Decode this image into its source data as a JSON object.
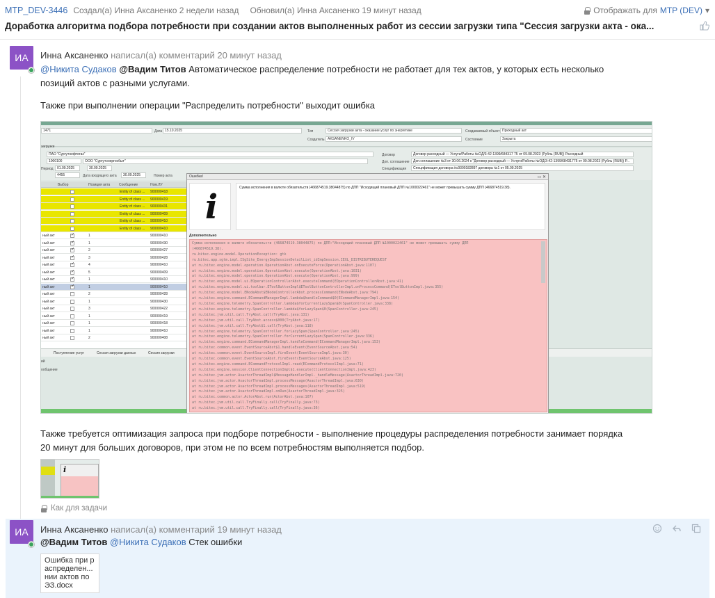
{
  "header": {
    "issue_key": "MTP_DEV-3446",
    "created": "Создал(а) Инна Аксаненко 2 недели назад",
    "updated": "Обновил(а) Инна Аксаненко 19 минут назад",
    "visibility_prefix": "Отображать для",
    "visibility_value": "MTP (DEV)",
    "caret": "▾",
    "like_icon": "thumbs-up-icon"
  },
  "issue": {
    "title": "Доработка алгоритма подбора потребности при создании актов выполненных работ из сессии загрузки типа \"Сессия загрузки акта - ока..."
  },
  "comments": [
    {
      "avatar_initials": "ИА",
      "author": "Инна Аксаненко",
      "action": "написал(а) комментарий 20 минут назад",
      "mention1": "@Никита Судаков",
      "mention2": "@Вадим Титов",
      "text1": "Автоматическое распределение потребности не работает для тех актов, у которых есть несколько",
      "text1b": "позиций актов с разными услугами.",
      "text2": "Также при выполнении операции \"Распределить потребности\" выходит ошибка",
      "text3": "Также требуется оптимизация запроса при подборе потребности - выполнение процедуры распределения потребности занимает порядка",
      "text3b": "20 минут для больших договоров, при этом не по всем потребностям выполняется подбор.",
      "visibility": "Как для задачи"
    },
    {
      "avatar_initials": "ИА",
      "author": "Инна Аксаненко",
      "action": "написал(а) комментарий 19 минут назад",
      "mention1": "@Вадим Титов",
      "mention2": "@Никита Судаков",
      "text1": "Стек ошибки",
      "attachment": "Ошибка при р аспределен... нии актов по ЭЗ.docx",
      "actions": [
        "emoji-icon",
        "reply-icon",
        "copy-icon"
      ]
    }
  ],
  "screenshot": {
    "form": {
      "num": "1471",
      "date_label": "Дата",
      "date": "15.10.2025",
      "type_label": "Тип",
      "type_value": "Сессия загрузки акта - оказание услуг по энергетике",
      "created_by_label": "Создатель",
      "created_by": "AKSANENKO_IV",
      "obj_label": "Создаваемый объект",
      "obj_value": "Приходный акт",
      "state_label": "Состояние",
      "state_value": "Закрыта",
      "tab": "загрузки",
      "org1": "ПАО \"Сургутнефтегаз\"",
      "code": "1000100",
      "org2": "ООО \"Сургутэнергосбыт\"",
      "contract_label": "Договор",
      "contract_value": "Договор расходный — Услуги/Работы №ОД/3-42-1399/684317 75 от 09.08.2023 (Рубль (RUB)) Расходный",
      "agreement_label": "Доп. соглашение",
      "agreement_value": "Доп.соглашение №3 от 30.06.2024 к \"Договор расходный — Услуги/Работы №ОД/3-42-1399/68431775 от 09.08.2023 (Рубль (RUB)) Р...",
      "period_label": "Период",
      "period_from": "01.09.2025",
      "period_to": "30.09.2025",
      "spec_label": "Спецификация",
      "spec_value": "Спецификация договора №9300182897 договора №1 от 05.09.2025",
      "doc_label": "Номер акта",
      "doc_num": "4455",
      "doc_date_label": "Дата входящего акта",
      "doc_date": "30.09.2025"
    },
    "grid_head": [
      "Выбор",
      "Позиция акта",
      "Сообщение",
      "Ном.ЛУ"
    ],
    "grid_rows": [
      {
        "color": "yellow",
        "checked": false,
        "pos": "",
        "msg": "Entity of class ...",
        "num": "900000418",
        "lbl": ""
      },
      {
        "color": "yellow",
        "checked": false,
        "pos": "",
        "msg": "Entity of class ...",
        "num": "900000419",
        "lbl": ""
      },
      {
        "color": "yellow",
        "checked": false,
        "pos": "",
        "msg": "Entity of class ...",
        "num": "900000431",
        "lbl": ""
      },
      {
        "color": "yellow",
        "checked": false,
        "pos": "",
        "msg": "Entity of class ...",
        "num": "900000409",
        "lbl": ""
      },
      {
        "color": "yellow",
        "checked": false,
        "pos": "",
        "msg": "Entity of class ...",
        "num": "900000410",
        "lbl": ""
      },
      {
        "color": "yellow",
        "checked": false,
        "pos": "",
        "msg": "Entity of class ...",
        "num": "900000410",
        "lbl": ""
      },
      {
        "color": "white",
        "checked": true,
        "pos": "1",
        "msg": "",
        "num": "900000410",
        "lbl": "ный акт"
      },
      {
        "color": "white",
        "checked": true,
        "pos": "1",
        "msg": "",
        "num": "900000430",
        "lbl": "ный акт"
      },
      {
        "color": "white",
        "checked": true,
        "pos": "2",
        "msg": "",
        "num": "900000427",
        "lbl": "ный акт"
      },
      {
        "color": "white",
        "checked": true,
        "pos": "3",
        "msg": "",
        "num": "900000428",
        "lbl": "ный акт"
      },
      {
        "color": "white",
        "checked": true,
        "pos": "4",
        "msg": "",
        "num": "900000410",
        "lbl": "ный акт"
      },
      {
        "color": "white",
        "checked": true,
        "pos": "5",
        "msg": "",
        "num": "900000409",
        "lbl": "ный акт"
      },
      {
        "color": "white",
        "checked": true,
        "pos": "1",
        "msg": "",
        "num": "900000410",
        "lbl": "ный акт"
      },
      {
        "color": "sel",
        "checked": true,
        "pos": "1",
        "msg": "",
        "num": "900000410",
        "lbl": "ный акт"
      },
      {
        "color": "white",
        "checked": false,
        "pos": "2",
        "msg": "",
        "num": "900000428",
        "lbl": "ный акт"
      },
      {
        "color": "white",
        "checked": false,
        "pos": "1",
        "msg": "",
        "num": "900000430",
        "lbl": "ный акт"
      },
      {
        "color": "white",
        "checked": false,
        "pos": "3",
        "msg": "",
        "num": "900000422",
        "lbl": "ный акт"
      },
      {
        "color": "white",
        "checked": false,
        "pos": "1",
        "msg": "",
        "num": "900000419",
        "lbl": "ный акт"
      },
      {
        "color": "white",
        "checked": false,
        "pos": "1",
        "msg": "",
        "num": "900000418",
        "lbl": "ный акт"
      },
      {
        "color": "white",
        "checked": false,
        "pos": "1",
        "msg": "",
        "num": "900000410",
        "lbl": "ный акт"
      },
      {
        "color": "white",
        "checked": false,
        "pos": "2",
        "msg": "",
        "num": "900000408",
        "lbl": "ный акт"
      }
    ],
    "tabs": [
      "Поступление услуг",
      "Сессия загрузки данных",
      "Сессия загрузки"
    ],
    "tabs_extra": [
      "ий",
      "ообщение"
    ],
    "dialog": {
      "title": "Ошибка!",
      "buttons": "▭ ✕",
      "message": "Сумма исполнения в валюте обязательств (466874519.38044875) по ДПП \"Исходящий плановый ДПП №1000022461\" не может превышать сумму ДПП (466874519.38).",
      "extra_label": "Дополнительно",
      "stack": [
        "Сумма исполнения в валюте обязательств (466874519.38044875) по ДПП:\"Исходящий плановый ДПП №1000022461\" не может превышать сумму ДПП",
        "(466874519.38).",
        "ru.bitec.engine.model.OperationException: gtk",
        "ru.bitec.app.sgtm.impl.ISgSite_EnergyImpSessionDetailList_idImpSession.IEXL_DISTRIBUTEREQUEST",
        "at ru.bitec.engine.model.operation.OperationAbst.onExecuteForce(OperationAbst.java:1107)",
        "at ru.bitec.engine.model.operation.OperationAbst.execute(OperationAbst.java:1031)",
        "at ru.bitec.engine.model.operation.OperationAbst.execute(OperationAbst.java:999)",
        "at ru.bitec.engine.model.ui.EOperationControllerAbst.executeCommand(EOperationControllerAbst.java:41)",
        "at ru.bitec.engine.model.ui.toolbar.EToolButtonImpl$EToolButtonControllerImpl.onProcessCommand(EToolButtonImpl.java:355)",
        "at ru.bitec.engine.model.ENodeAbst$ENodeControllerAbst.processCommand(ENodeAbst.java:794)",
        "at ru.bitec.engine.command.ECommandManagerImpl.lambda$handleCommand$0(ECommandManagerImpl.java:154)",
        "at ru.bitec.engine.telemetry.SpanController.lambda$forCurrentLazySpan$0(SpanController.java:338)",
        "at ru.bitec.engine.telemetry.SpanController.lambda$forLazySpan$0(SpanController.java:245)",
        "at ru.bitec.jvm.util.call.TryAbst.call(TryAbst.java:131)",
        "at ru.bitec.jvm.util.call.TryAbst.access$000(TryAbst.java:17)",
        "at ru.bitec.jvm.util.call.TryAbst$1.call(TryAbst.java:118)",
        "at ru.bitec.engine.telemetry.SpanController.forLazySpan(SpanController.java:245)",
        "at ru.bitec.engine.telemetry.SpanController.forCurrentLazySpan(SpanController.java:336)",
        "at ru.bitec.engine.command.ECommandManagerImpl.handleCommand(ECommandManagerImpl.java:153)",
        "at ru.bitec.common.event.EventSourceAbst$1.handleEvent(EventSourceAbst.java:54)",
        "at ru.bitec.common.event.EventSourceImpl.fireEvent(EventSourceImpl.java:30)",
        "at ru.bitec.common.event.EventSourceAbst.fireEvent(EventSourceAbst.java:125)",
        "at ru.bitec.engine.command.ECommandProtocolImpl.read(ECommandProtocolImpl.java:71)",
        "at ru.bitec.engine.session.ClientConnectionImpl$1.execute(ClientConnectionImpl.java:423)",
        "at ru.bitec.jvm.actor.AsactorThreadImpl$MessageHandlerImpl._handleMessage(AsactorThreadImpl.java:720)",
        "at ru.bitec.jvm.actor.AsactorThreadImpl.processMessage(AsactorThreadImpl.java:630)",
        "at ru.bitec.jvm.actor.AsactorThreadImpl.processMessages(AsactorThreadImpl.java:519)",
        "at ru.bitec.jvm.actor.AsactorThreadImpl.onRun(AsactorThreadImpl.java:325)",
        "at ru.bitec.common.actor.ActorAbst.run(ActorAbst.java:107)",
        "at ru.bitec.jvm.util.call.TryFinally.call(TryFinally.java:73)",
        "at ru.bitec.jvm.util.call.TryFinally.call(TryFinally.java:36)",
        "at ru.bitec.engine.session.AsactorThreadBuilderImpl.lambda$null$0(AsactorThreadBuilderImpl.java:23)",
        "at ru.bitec.jvm.util.call.Safe.call(Safe.java:58)"
      ]
    }
  },
  "colors": {
    "accent": "#3b6fb6",
    "avatar": "#8c52c6",
    "highlight_bg": "#eaf3fc",
    "error_bg": "#f9c2c2"
  }
}
